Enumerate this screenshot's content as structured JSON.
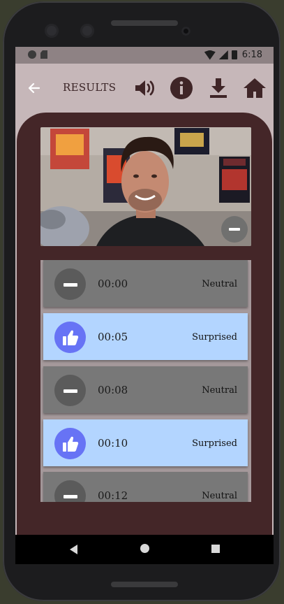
{
  "status_bar": {
    "time": "6:18"
  },
  "app_bar": {
    "title": "RESULTS",
    "icons": [
      "back-arrow-icon",
      "volume-icon",
      "info-icon",
      "download-icon",
      "home-icon"
    ]
  },
  "video": {
    "remove_icon": "minus-icon"
  },
  "results": [
    {
      "time": "00:00",
      "emotion": "Neutral",
      "icon": "minus-icon"
    },
    {
      "time": "00:05",
      "emotion": "Surprised",
      "icon": "thumbs-up-icon"
    },
    {
      "time": "00:08",
      "emotion": "Neutral",
      "icon": "minus-icon"
    },
    {
      "time": "00:10",
      "emotion": "Surprised",
      "icon": "thumbs-up-icon"
    },
    {
      "time": "00:12",
      "emotion": "Neutral",
      "icon": "minus-icon"
    }
  ],
  "colors": {
    "appbar": "#c6b7b9",
    "panel": "#442628",
    "neutral_row": "#787878",
    "surprised_row": "#b3d5ff",
    "surprised_icon": "#6773f5"
  }
}
